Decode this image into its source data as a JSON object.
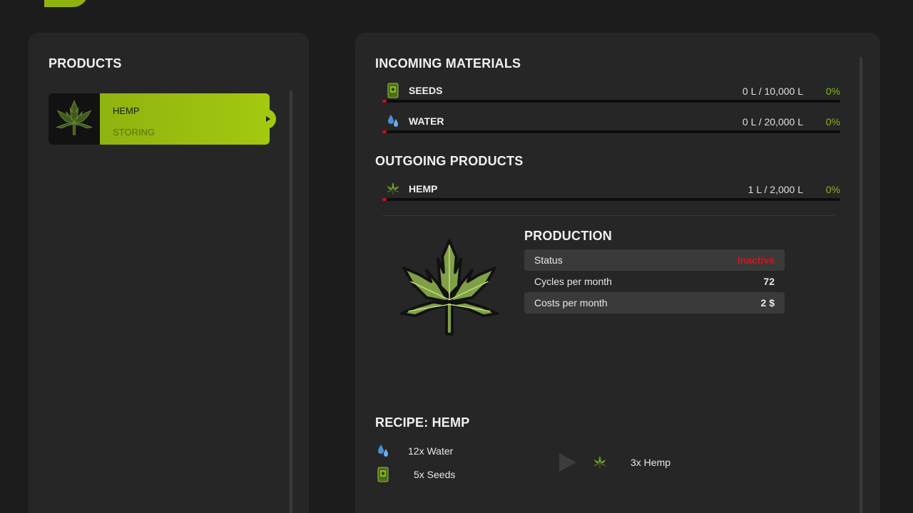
{
  "products_panel": {
    "title": "PRODUCTS",
    "items": [
      {
        "name": "HEMP",
        "status": "STORING",
        "icon": "hemp-leaf-icon"
      }
    ]
  },
  "incoming": {
    "title": "INCOMING MATERIALS",
    "rows": [
      {
        "label": "SEEDS",
        "amount": "0 L / 10,000 L",
        "percent": "0%",
        "fill": 0,
        "icon": "seeds-bag-icon"
      },
      {
        "label": "WATER",
        "amount": "0 L / 20,000 L",
        "percent": "0%",
        "fill": 0,
        "icon": "water-drop-icon"
      }
    ]
  },
  "outgoing": {
    "title": "OUTGOING PRODUCTS",
    "rows": [
      {
        "label": "HEMP",
        "amount": "1 L / 2,000 L",
        "percent": "0%",
        "fill": 0,
        "icon": "hemp-leaf-icon"
      }
    ]
  },
  "production": {
    "title": "PRODUCTION",
    "rows": [
      {
        "label": "Status",
        "value": "Inactive"
      },
      {
        "label": "Cycles per month",
        "value": "72"
      },
      {
        "label": "Costs per month",
        "value": "2 $"
      }
    ]
  },
  "recipe": {
    "title": "RECIPE: HEMP",
    "inputs": [
      {
        "text": "12x Water",
        "icon": "water-drop-icon"
      },
      {
        "text": "5x Seeds",
        "icon": "seeds-bag-icon"
      }
    ],
    "output": {
      "text": "3x Hemp",
      "icon": "hemp-leaf-icon"
    }
  },
  "colors": {
    "accent": "#a3c90f",
    "status_inactive": "#d8121c",
    "percent": "#86b51a",
    "bar_fill": "#d0101a"
  }
}
